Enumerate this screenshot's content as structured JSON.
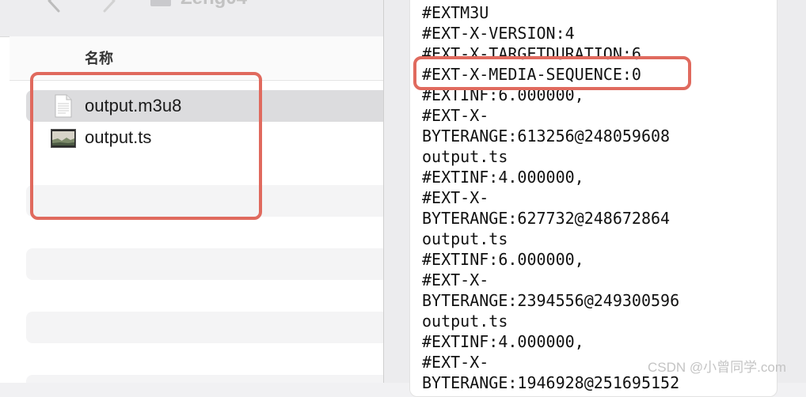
{
  "finder": {
    "window_title": "Zeng04",
    "column_name": "名称",
    "files": [
      {
        "name": "output.m3u8",
        "icon": "document-icon",
        "selected": true
      },
      {
        "name": "output.ts",
        "icon": "video-thumbnail-icon",
        "selected": false
      }
    ]
  },
  "editor": {
    "lines": [
      "#EXTM3U",
      "#EXT-X-VERSION:4",
      "#EXT-X-TARGETDURATION:6",
      "#EXT-X-MEDIA-SEQUENCE:0",
      "#EXTINF:6.000000,",
      "#EXT-X-",
      "BYTERANGE:613256@248059608",
      "output.ts",
      "#EXTINF:4.000000,",
      "#EXT-X-",
      "BYTERANGE:627732@248672864",
      "output.ts",
      "#EXTINF:6.000000,",
      "#EXT-X-",
      "BYTERANGE:2394556@249300596",
      "output.ts",
      "#EXTINF:4.000000,",
      "#EXT-X-",
      "BYTERANGE:1946928@251695152"
    ]
  },
  "annotations": {
    "highlight_color": "#e06a5e",
    "highlighted_line": "#EXT-X-MEDIA-SEQUENCE:0"
  },
  "watermark": "CSDN @小曾同学.com"
}
